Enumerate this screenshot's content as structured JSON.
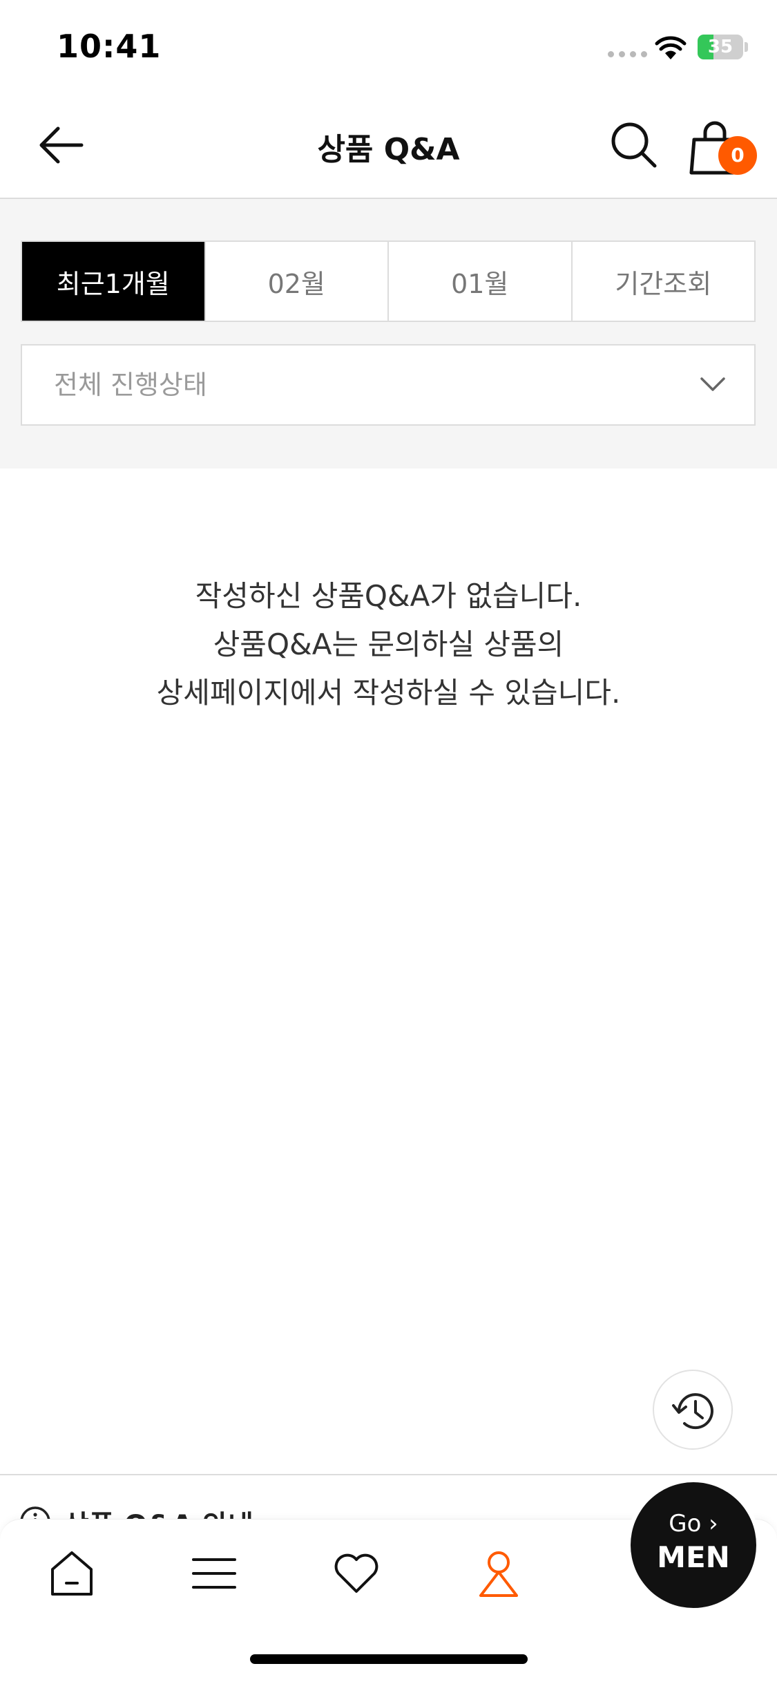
{
  "status_bar": {
    "time": "10:41",
    "battery": "35",
    "battery_level_percent": 35
  },
  "header": {
    "title": "상품 Q&A",
    "cart_count": "0"
  },
  "filters": {
    "tabs": [
      {
        "label": "최근1개월",
        "active": true
      },
      {
        "label": "02월",
        "active": false
      },
      {
        "label": "01월",
        "active": false
      },
      {
        "label": "기간조회",
        "active": false
      }
    ],
    "status_select": "전체 진행상태"
  },
  "empty_state": {
    "line1": "작성하신 상품Q&A가 없습니다.",
    "line2": "상품Q&A는 문의하실 상품의",
    "line3": "상세페이지에서 작성하실 수 있습니다."
  },
  "info_bar": {
    "label": "상품 Q&A 안내"
  },
  "go_men": {
    "line1": "Go ›",
    "line2": "MEN"
  },
  "colors": {
    "accent": "#ff5a00",
    "active_tab": "#000000",
    "battery": "#34c759"
  },
  "icons": [
    "back-arrow-icon",
    "search-icon",
    "cart-icon",
    "chevron-down-icon",
    "history-icon",
    "info-icon",
    "home-icon",
    "menu-icon",
    "heart-icon",
    "person-icon"
  ]
}
